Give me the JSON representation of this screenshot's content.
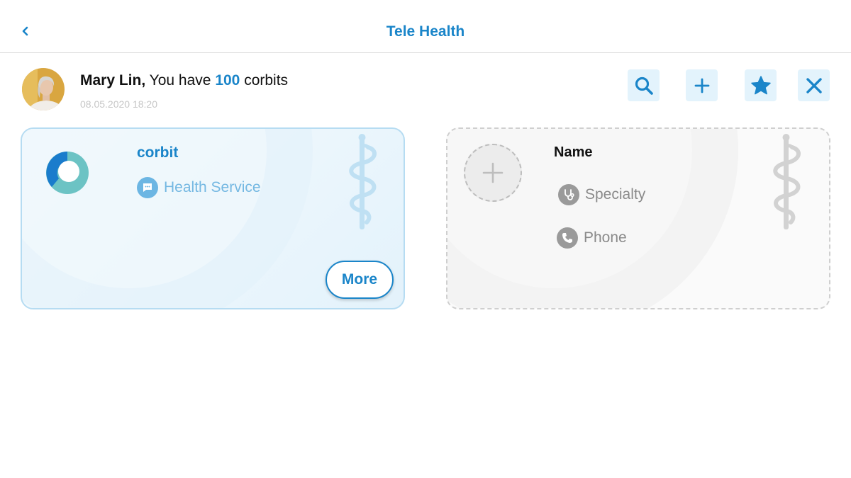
{
  "header": {
    "title": "Tele Health"
  },
  "user": {
    "name": "Mary Lin,",
    "greeting_prefix": "You have",
    "corbit_count": "100",
    "corbit_unit": "corbits",
    "timestamp": "08.05.2020 18:20"
  },
  "toolbar": {
    "icons": [
      "search-icon",
      "plus-icon",
      "star-icon",
      "close-icon"
    ]
  },
  "service_card": {
    "title": "corbit",
    "service_label": "Health Service",
    "more_label": "More"
  },
  "empty_card": {
    "name_label": "Name",
    "specialty_label": "Specialty",
    "phone_label": "Phone"
  },
  "colors": {
    "accent": "#1a85c9",
    "icon_bg": "#e3f3fc",
    "card_border": "#b6dcf2",
    "muted": "#8a8a8a"
  }
}
